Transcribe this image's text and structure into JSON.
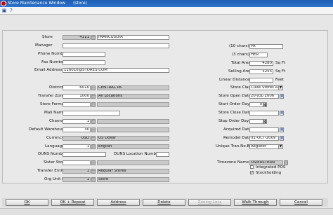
{
  "window": {
    "title": "Store Maintenance Window",
    "context": "(store)"
  },
  "toolbar_icons": [
    "save-icon",
    "help-icon"
  ],
  "left": {
    "store": {
      "label": "Store",
      "number": "4111",
      "name": "IMANCUSO/A"
    },
    "manager": {
      "label": "Manager",
      "value": ""
    },
    "phone": {
      "label": "Phone Number",
      "value": ""
    },
    "fax": {
      "label": "Fax Number",
      "value": ""
    },
    "email": {
      "label": "Email Address",
      "value": "116010@STORES.COM"
    },
    "district": {
      "label": "District",
      "number": "6010",
      "name": "CENTRAL PA"
    },
    "transfer_zone": {
      "label": "Transfer Zone",
      "number": "1000",
      "name": "All Locations"
    },
    "store_format": {
      "label": "Store Format",
      "value": ""
    },
    "mall_name": {
      "label": "Mall Name",
      "value": ""
    },
    "channel": {
      "label": "Channel",
      "value": "1"
    },
    "default_wh": {
      "label": "Default Warehouse",
      "value": "30"
    },
    "currency": {
      "label": "Currency",
      "code": "USD",
      "name": "US Dollar"
    },
    "language": {
      "label": "Language",
      "number": "1",
      "name": "English"
    },
    "duns": {
      "label": "DUNS Number",
      "value": ""
    },
    "duns_loc": {
      "label": "DUNS Location Number",
      "value": ""
    },
    "sister_store": {
      "label": "Sister Store",
      "value": ""
    },
    "transfer_entity": {
      "label": "Transfer Entity",
      "number": "1",
      "name": "Regular Stores"
    },
    "org_unit": {
      "label": "Org Unit ID",
      "number": "1",
      "name": "Store"
    }
  },
  "right": {
    "ten_chars": {
      "label": "(10 chars)",
      "value": "PA"
    },
    "three_chars": {
      "label": "(3 chars)",
      "value": "HER"
    },
    "total_area": {
      "label": "Total Area",
      "value": "4280",
      "unit": "Sq Ft"
    },
    "selling_area": {
      "label": "Selling Area",
      "value": "3255",
      "unit": "Sq Ft"
    },
    "linear_distance": {
      "label": "Linear Distance",
      "value": "",
      "unit": "Feet"
    },
    "store_class": {
      "label": "Store Class",
      "value": "Class Stores A"
    },
    "open_date": {
      "label": "Store Open Date",
      "value": "20-JUL-2006"
    },
    "start_order_days": {
      "label": "Start Order Days",
      "value": "0"
    },
    "close_date": {
      "label": "Store Close Date",
      "value": ""
    },
    "stop_order_days": {
      "label": "Stop Order Days",
      "value": ""
    },
    "acquired_date": {
      "label": "Acquired Date",
      "value": ""
    },
    "remodel_date": {
      "label": "Remodel Date",
      "value": "01-OCT-2009"
    },
    "unique_tran": {
      "label": "Unique Tran.No.By",
      "value": "Register"
    },
    "timezone": {
      "label": "Timezone Name",
      "value": "US/EASTERN"
    },
    "integrated_pos": {
      "label": "Integrated POS",
      "checked": false
    },
    "stockholding": {
      "label": "Stockholding",
      "checked": true
    }
  },
  "buttons": {
    "ok": "OK",
    "ok_repeat": "OK + Repeat",
    "address": "Address",
    "delete": "Delete",
    "zoning_locs": "Zoning Locs",
    "walk_through": "Walk Through",
    "cancel": "Cancel"
  }
}
